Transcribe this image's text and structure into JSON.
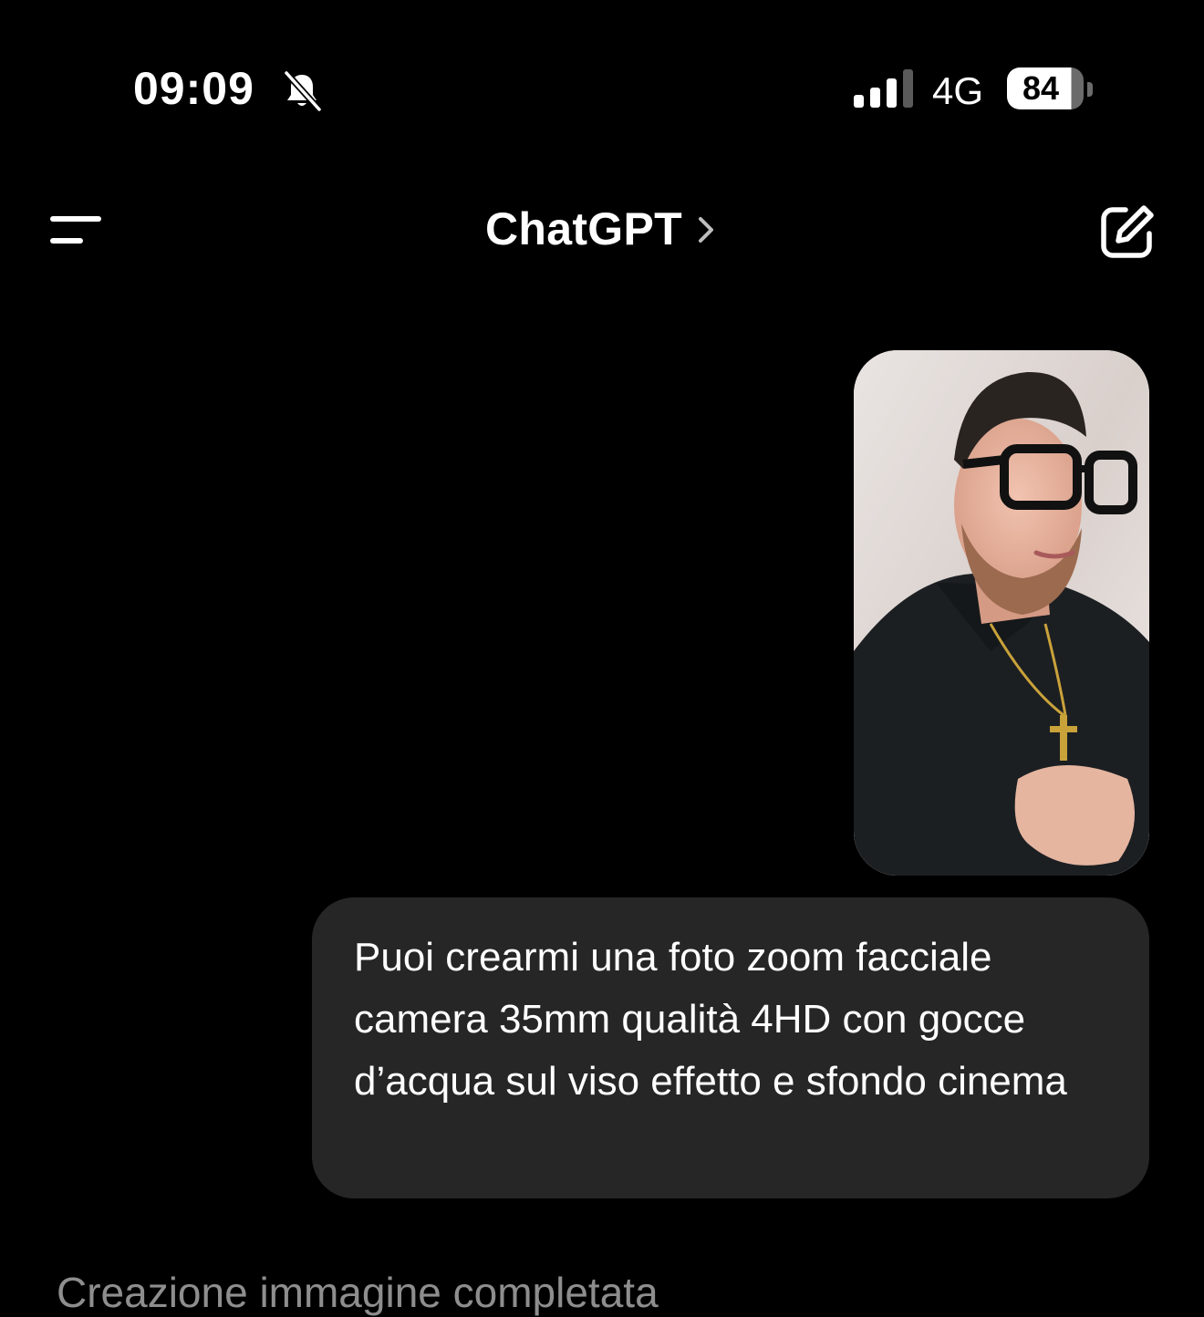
{
  "status_bar": {
    "time": "09:09",
    "network": "4G",
    "battery": "84",
    "icons": [
      "bell-slash-icon",
      "signal-icon",
      "battery-icon"
    ]
  },
  "header": {
    "title": "ChatGPT",
    "icons": [
      "menu-icon",
      "chevron-right-icon",
      "compose-icon"
    ]
  },
  "conversation": {
    "user_image": {
      "description_icon": "photo-attachment"
    },
    "user_message": "Puoi crearmi una foto zoom facciale camera 35mm qualità 4HD con gocce d’acqua sul viso effetto e sfondo cinema",
    "assistant_status": "Creazione immagine completata"
  },
  "colors": {
    "background": "#000000",
    "bubble": "#262626",
    "status_text": "#8e8e8e",
    "text": "#ffffff"
  }
}
